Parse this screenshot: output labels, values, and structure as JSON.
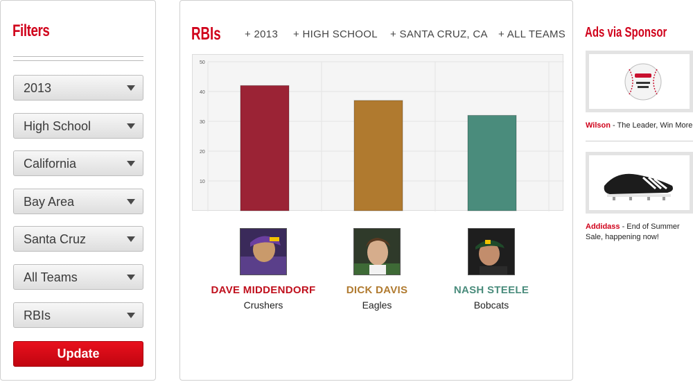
{
  "filters": {
    "title": "Filters",
    "selects": [
      {
        "label": "2013"
      },
      {
        "label": "High School"
      },
      {
        "label": "California"
      },
      {
        "label": "Bay Area"
      },
      {
        "label": "Santa Cruz"
      },
      {
        "label": "All Teams"
      },
      {
        "label": "RBIs"
      }
    ],
    "update_label": "Update"
  },
  "main": {
    "title": "RBIs",
    "tags": [
      "+ 2013",
      "+ HIGH SCHOOL",
      "+ SANTA CRUZ, CA",
      "+ ALL TEAMS"
    ]
  },
  "chart_data": {
    "type": "bar",
    "categories": [
      "DAVE MIDDENDORF",
      "DICK DAVIS",
      "NASH STEELE"
    ],
    "values": [
      42,
      37,
      32
    ],
    "colors": [
      "#9b2335",
      "#b07a2f",
      "#4a8c7c"
    ],
    "ylim": [
      0,
      50
    ],
    "yticks": [
      10,
      20,
      30,
      40,
      50
    ],
    "grid": true
  },
  "players": [
    {
      "name": "DAVE MIDDENDORF",
      "team": "Crushers",
      "color": "#c0101d"
    },
    {
      "name": "DICK DAVIS",
      "team": "Eagles",
      "color": "#b07a2f"
    },
    {
      "name": "NASH STEELE",
      "team": "Bobcats",
      "color": "#4a8c7c"
    }
  ],
  "ads": {
    "title": "Ads via Sponsor",
    "items": [
      {
        "brand": "Wilson",
        "text": " - The Leader, Win More",
        "icon": "baseball-icon"
      },
      {
        "brand": "Addidass",
        "text": " - End of Summer Sale, happening now!",
        "icon": "cleat-icon"
      }
    ]
  }
}
